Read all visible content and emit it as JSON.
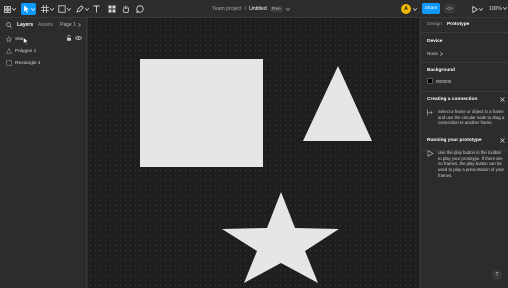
{
  "toolbar": {
    "icons": [
      "figma-menu-icon",
      "move-tool-icon",
      "frame-tool-icon",
      "shape-tool-icon",
      "pen-tool-icon",
      "text-tool-icon",
      "resources-icon",
      "hand-tool-icon",
      "comment-tool-icon"
    ],
    "active_tool": "move-tool-icon",
    "accent_color": "#0d99ff",
    "breadcrumb_team": "Team project",
    "breadcrumb_sep": "/",
    "file_name": "Untitled",
    "plan_badge": "Free",
    "avatar_letter": "A",
    "avatar_color": "#f2b705",
    "share_label": "Share",
    "dev_mode_label": "</>",
    "zoom_label": "100%"
  },
  "left_panel": {
    "tabs": [
      {
        "label": "Layers",
        "active": true
      },
      {
        "label": "Assets",
        "active": false
      }
    ],
    "page_label": "Page 1",
    "layers": [
      {
        "name": "Star",
        "icon": "star-icon",
        "selected": false
      },
      {
        "name": "Polygon 1",
        "icon": "polygon-icon",
        "selected": false
      },
      {
        "name": "Rectangle 1",
        "icon": "rectangle-icon",
        "selected": false
      }
    ]
  },
  "right_panel": {
    "tabs": [
      {
        "label": "Design",
        "active": false
      },
      {
        "label": "Prototype",
        "active": true
      }
    ],
    "device_title": "Device",
    "device_value": "None",
    "background_title": "Background",
    "background_hex": "000000",
    "background_color": "#000000",
    "tips": [
      {
        "title": "Creating a connection",
        "icon": "connection-icon",
        "text": "Select a frame or object in a frame and use the circular node to drag a connection to another frame."
      },
      {
        "title": "Running your prototype",
        "icon": "play-icon",
        "text": "Use the play button in the toolbar to play your prototype. If there are no frames, the play button can be used to play a presentation of your frames."
      }
    ],
    "help_label": "?"
  },
  "canvas": {
    "background": "#1e1e1e",
    "shape_fill": "#e6e6e6",
    "shapes": [
      "rectangle",
      "triangle",
      "star"
    ]
  }
}
